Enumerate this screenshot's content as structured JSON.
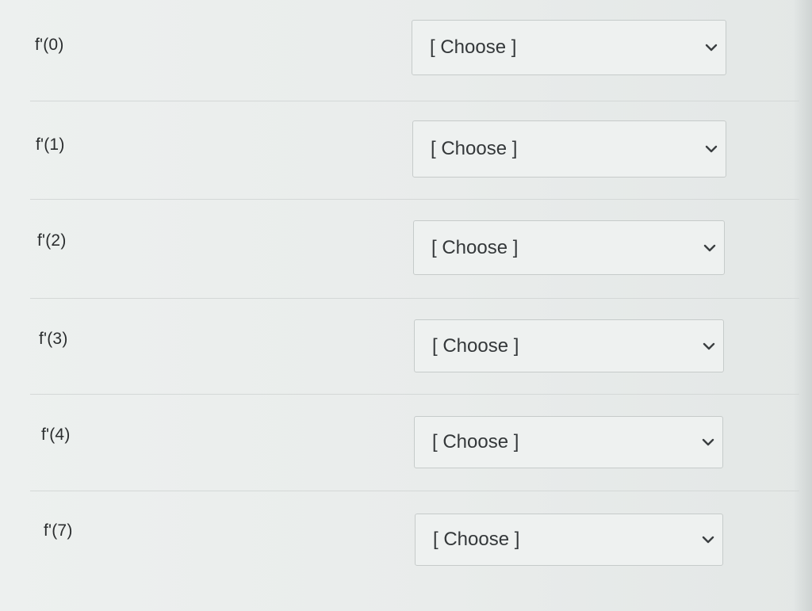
{
  "questions": [
    {
      "label": "f'(0)",
      "selected": "[ Choose ]"
    },
    {
      "label": "f'(1)",
      "selected": "[ Choose ]"
    },
    {
      "label": "f'(2)",
      "selected": "[ Choose ]"
    },
    {
      "label": "f'(3)",
      "selected": "[ Choose ]"
    },
    {
      "label": "f'(4)",
      "selected": "[ Choose ]"
    },
    {
      "label": "f'(7)",
      "selected": "[ Choose ]"
    }
  ],
  "icons": {
    "dropdown": "chevron-down-icon"
  },
  "colors": {
    "background": "#e9eceb",
    "text": "#2a2d2e",
    "border": "#c6cbca"
  }
}
